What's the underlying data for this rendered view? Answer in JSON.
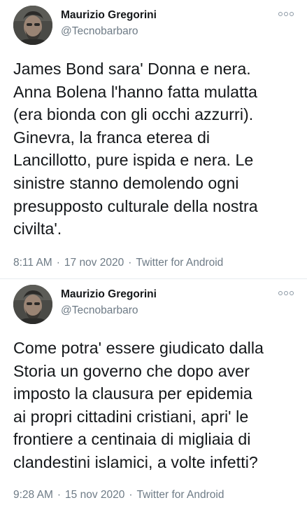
{
  "tweets": [
    {
      "author": {
        "name": "Maurizio Gregorini",
        "handle": "@Tecnobarbaro"
      },
      "text": "James Bond sara' Donna e nera.\nAnna Bolena l'hanno fatta mulatta\n(era bionda con gli occhi azzurri).\nGinevra, la franca eterea di\nLancillotto, pure ispida e nera. Le\nsinistre stanno demolendo ogni\npresupposto culturale della nostra\ncivilta'.",
      "time": "8:11 AM",
      "date": "17 nov 2020",
      "separator": "·",
      "client": "Twitter for Android"
    },
    {
      "author": {
        "name": "Maurizio Gregorini",
        "handle": "@Tecnobarbaro"
      },
      "text": "Come potra' essere giudicato dalla\nStoria un governo che dopo aver\nimposto la clausura per epidemia\nai propri cittadini cristiani, apri' le\nfrontiere a centinaia di migliaia di\nclandestini islamici, a volte infetti?",
      "time": "9:28 AM",
      "date": "15 nov 2020",
      "separator": "·",
      "client": "Twitter for Android"
    }
  ],
  "icons": {
    "more": "more-options-icon",
    "avatar": "profile-photo"
  },
  "colors": {
    "text": "#14171a",
    "secondary": "#6e7b86",
    "divider": "#e6ecf0",
    "background": "#ffffff"
  }
}
